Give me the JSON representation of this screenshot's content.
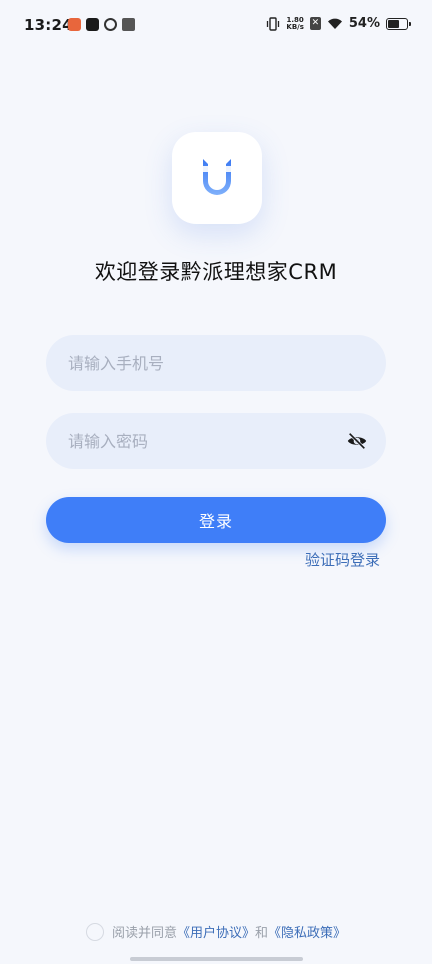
{
  "status_bar": {
    "time": "13:24",
    "apps": [
      "app-icon-1",
      "tiktok-icon",
      "link-app-icon",
      "store-app-icon"
    ],
    "net_speed_value": "1.80",
    "net_speed_unit": "KB/s",
    "battery": "54%"
  },
  "logo": {
    "icon": "magnet-u-logo",
    "color": "#4a86f5"
  },
  "title": "欢迎登录黔派理想家CRM",
  "phone": {
    "placeholder": "请输入手机号",
    "value": ""
  },
  "password": {
    "placeholder": "请输入密码",
    "value": "",
    "toggle_icon": "eye-off-icon"
  },
  "login_button": "登录",
  "code_login_link": "验证码登录",
  "agreement": {
    "prefix": "阅读并同意",
    "user_agreement": "《用户协议》",
    "conjunction": "和",
    "privacy_policy": "《隐私政策》"
  },
  "colors": {
    "background": "#f5f7fc",
    "primary": "#3f7ef8",
    "link": "#3d6eb8",
    "input_bg": "#e8eefa"
  }
}
